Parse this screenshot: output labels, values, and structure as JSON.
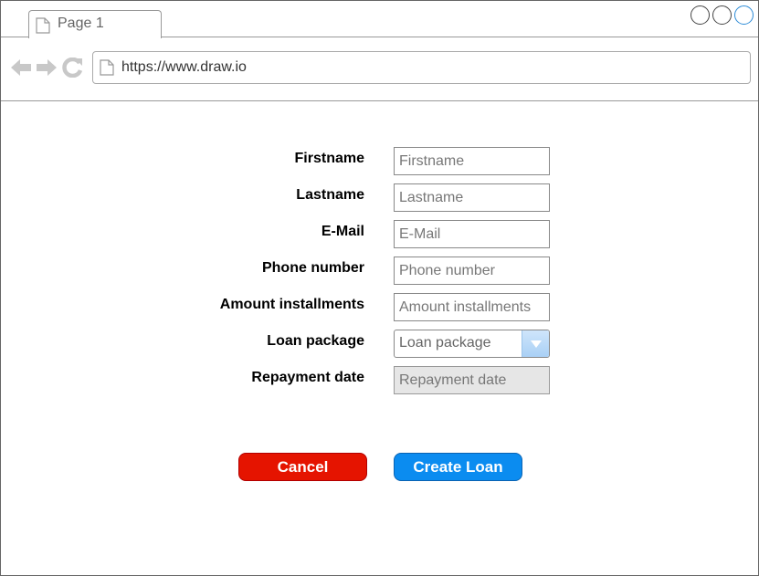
{
  "browser": {
    "tab_title": "Page 1",
    "url": "https://www.draw.io",
    "icons": {
      "tab": "page-icon",
      "back": "back-arrow-icon",
      "forward": "forward-arrow-icon",
      "reload": "reload-icon",
      "address": "page-icon"
    }
  },
  "form": {
    "fields": [
      {
        "label": "Firstname",
        "placeholder": "Firstname"
      },
      {
        "label": "Lastname",
        "placeholder": "Lastname"
      },
      {
        "label": "E-Mail",
        "placeholder": "E-Mail"
      },
      {
        "label": "Phone number",
        "placeholder": "Phone number"
      },
      {
        "label": "Amount installments",
        "placeholder": "Amount installments"
      },
      {
        "label": "Loan package",
        "value": "Loan package"
      },
      {
        "label": "Repayment date",
        "placeholder": "Repayment date"
      }
    ]
  },
  "actions": {
    "cancel_label": "Cancel",
    "create_label": "Create Loan"
  },
  "colors": {
    "cancel": "#e51400",
    "create": "#0b8cf0",
    "dropdown_arrow": "#a9d0f5"
  }
}
